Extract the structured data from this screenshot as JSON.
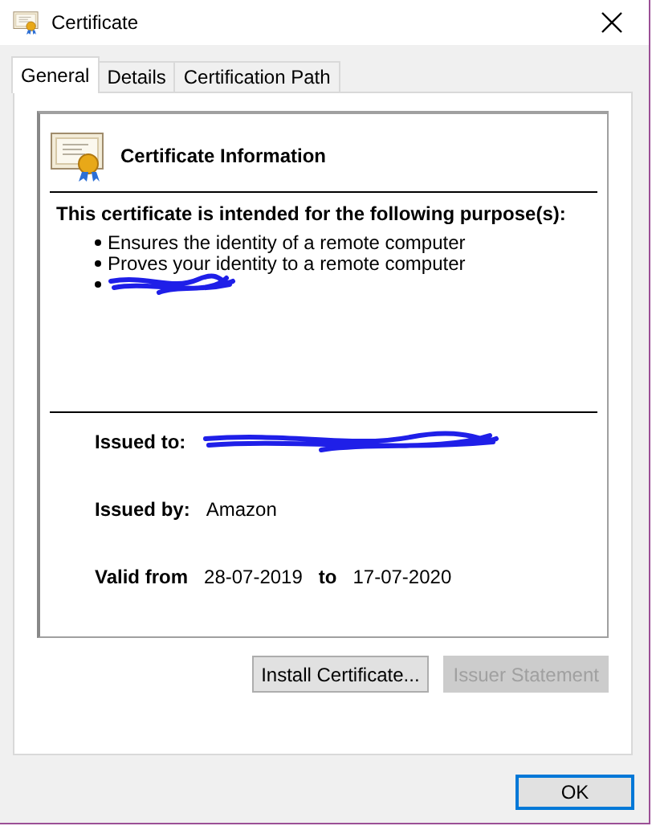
{
  "window": {
    "title": "Certificate"
  },
  "tabs": [
    {
      "label": "General",
      "selected": true
    },
    {
      "label": "Details",
      "selected": false
    },
    {
      "label": "Certification Path",
      "selected": false
    }
  ],
  "info": {
    "heading": "Certificate Information",
    "purpose_heading": "This certificate is intended for the following purpose(s):",
    "purposes": [
      {
        "kind": "text",
        "text": "Ensures the identity of a remote computer"
      },
      {
        "kind": "text",
        "text": "Proves your identity to a remote computer"
      },
      {
        "kind": "redacted"
      }
    ],
    "fields": [
      {
        "label": "Issued to:",
        "kind": "redacted"
      },
      {
        "label": "Issued by:",
        "kind": "text",
        "value": "Amazon"
      }
    ],
    "validity": {
      "label": "Valid from",
      "from": "28-07-2019",
      "to_label": "to",
      "to": "17-07-2020"
    }
  },
  "buttons": [
    {
      "label": "Install Certificate...",
      "disabled": false
    },
    {
      "label": "Issuer Statement",
      "disabled": true
    }
  ],
  "footer": {
    "ok": {
      "label": "OK",
      "default": true
    }
  }
}
